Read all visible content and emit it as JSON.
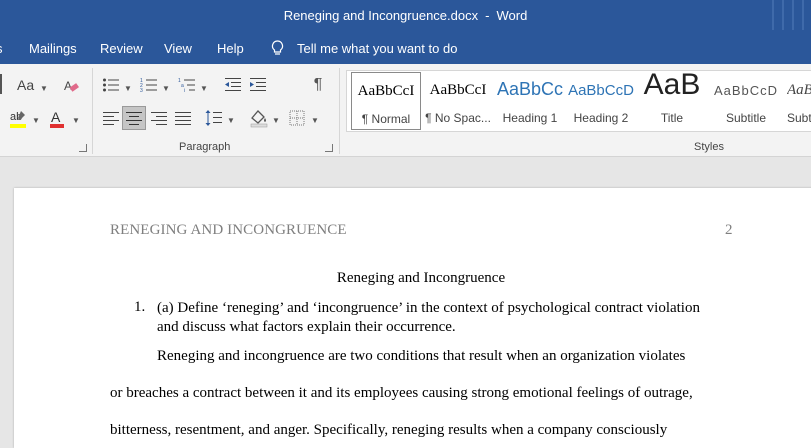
{
  "window": {
    "document_name": "Reneging and Incongruence.docx",
    "separator": "-",
    "app_name": "Word"
  },
  "tabs": [
    {
      "label": "Mailings"
    },
    {
      "label": "Review"
    },
    {
      "label": "View"
    },
    {
      "label": "Help"
    }
  ],
  "tell_me": "Tell me what you want to do",
  "ribbon": {
    "font_case_label": "Aa",
    "paragraph_label": "Paragraph",
    "styles_label": "Styles",
    "styles": [
      {
        "preview": "AaBbCcI",
        "name": "¶ Normal"
      },
      {
        "preview": "AaBbCcI",
        "name": "¶ No Spac..."
      },
      {
        "preview": "AaBbCc",
        "name": "Heading 1"
      },
      {
        "preview": "AaBbCcD",
        "name": "Heading 2"
      },
      {
        "preview": "AaB",
        "name": "Title"
      },
      {
        "preview": "AaBbCcD",
        "name": "Subtitle"
      },
      {
        "preview": "AaB",
        "name": "Subt"
      }
    ]
  },
  "document": {
    "running_header": "RENEGING AND INCONGRUENCE",
    "page_number": "2",
    "title": "Reneging and Incongruence",
    "list_number": "1.",
    "list_item": "(a) Define ‘reneging’ and ‘incongruence’ in the context of psychological contract violation and discuss what factors explain their occurrence.",
    "paragraph_lines": [
      "Reneging and incongruence are two conditions that result when an organization violates",
      "or breaches a contract between it and its employees causing strong emotional feelings of outrage,",
      "bitterness, resentment, and anger. Specifically, reneging results when a company consciously"
    ]
  },
  "colors": {
    "title_bar": "#2b579a",
    "ribbon": "#f3f3f3",
    "heading_blue": "#2e74b5",
    "highlight_yellow": "#ffff00",
    "font_color_red": "#e03030"
  }
}
